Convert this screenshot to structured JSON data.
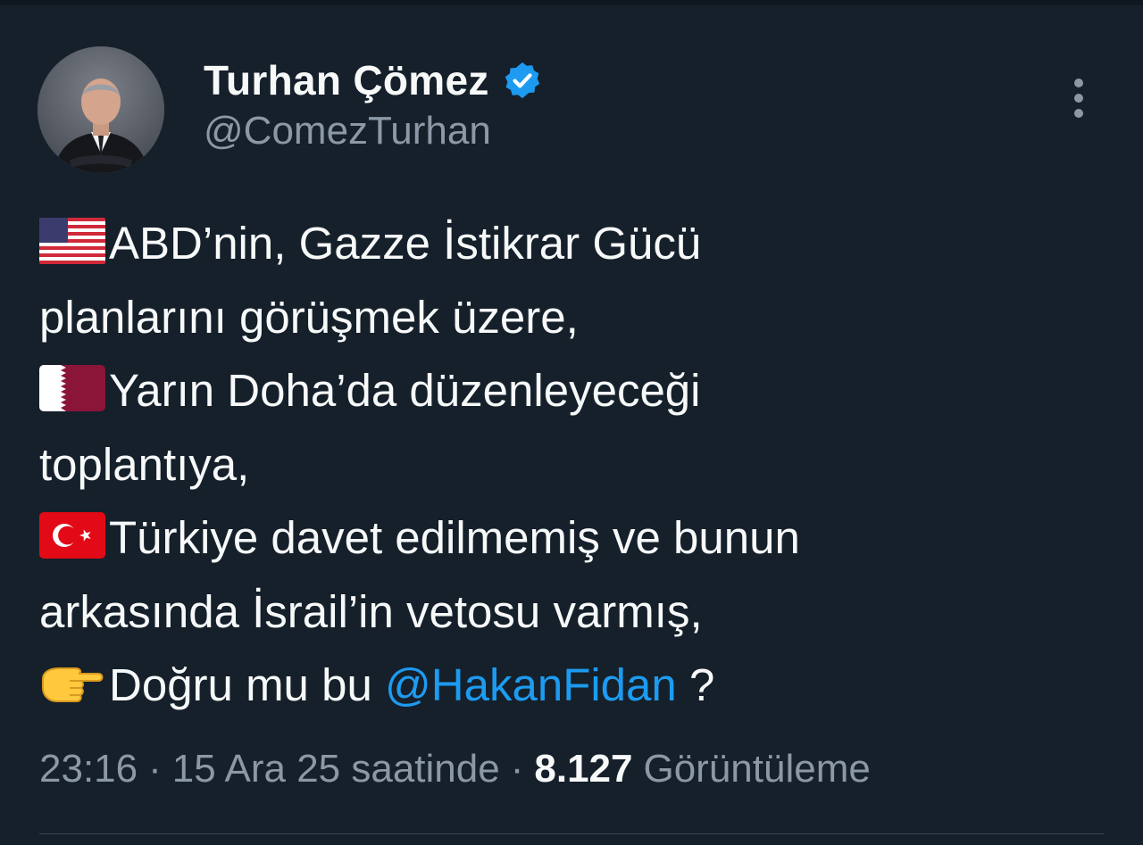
{
  "author": {
    "display_name": "Turhan Çömez",
    "handle": "@ComezTurhan",
    "verified_icon": "verified-badge-icon"
  },
  "tweet": {
    "lines": [
      {
        "icon": "us-flag-emoji",
        "text": "ABD’nin, Gazze İstikrar Gücü"
      },
      {
        "icon": "",
        "text": "planlarını görüşmek üzere,"
      },
      {
        "icon": "qatar-flag-emoji",
        "text": "Yarın Doha’da düzenleyeceği"
      },
      {
        "icon": "",
        "text": "toplantıya,"
      },
      {
        "icon": "turkey-flag-emoji",
        "text": "Türkiye davet edilmemiş ve bunun"
      },
      {
        "icon": "",
        "text": "arkasında İsrail’in vetosu varmış,"
      },
      {
        "icon": "pointing-right-emoji",
        "text": "Doğru mu bu ",
        "mention": "@HakanFidan",
        "suffix": " ?"
      }
    ]
  },
  "meta": {
    "time": "23:16",
    "separator": "·",
    "date": "15 Ara 25 saatinde",
    "views_count": "8.127",
    "views_label": "Görüntüleme"
  },
  "colors": {
    "background": "#15202b",
    "text": "#f7f9f9",
    "secondary": "#8b98a5",
    "accent": "#1d9bf0"
  }
}
